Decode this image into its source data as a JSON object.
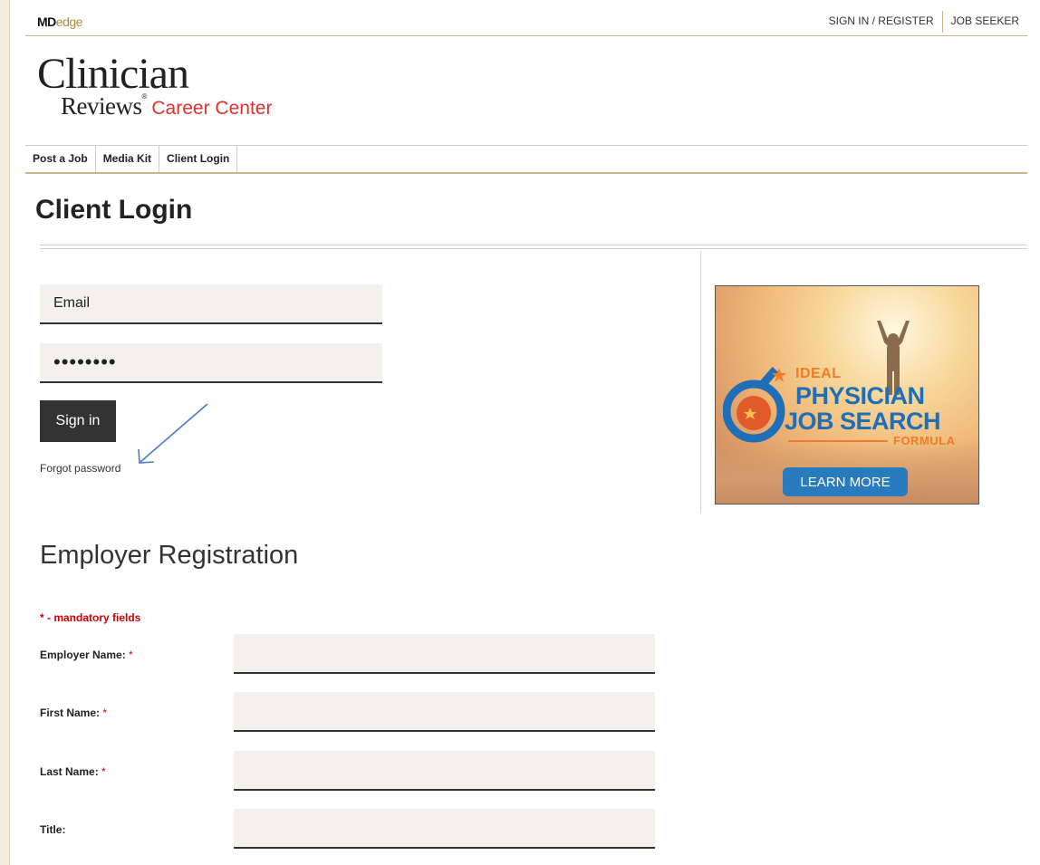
{
  "colors": {
    "accent_gold": "#c9b48a",
    "required_red": "#cc0000",
    "logo_red": "#e0302f",
    "button_dark": "#333333",
    "ad_blue": "#1e6fb8",
    "ad_orange": "#f07c28"
  },
  "brand": {
    "md": "MD",
    "edge": "edge"
  },
  "top_links": [
    "SIGN IN / REGISTER",
    "JOB SEEKER"
  ],
  "logo": {
    "main": "Clinician",
    "reviews": "Reviews",
    "reg_mark": "®",
    "career": "Career Center"
  },
  "nav": [
    "Post a Job",
    "Media Kit",
    "Client Login"
  ],
  "page_title": "Client Login",
  "login": {
    "email_placeholder": "Email",
    "password_value": "••••••••",
    "signin_label": "Sign in",
    "forgot_label": "Forgot password",
    "annotation_icon": "arrow-icon"
  },
  "ad": {
    "ideal": "IDEAL",
    "physician": "PHYSICIAN",
    "job_search": "JOB SEARCH",
    "formula": "FORMULA",
    "learn_more": "LEARN MORE"
  },
  "registration": {
    "title": "Employer Registration",
    "mandatory_note": "* - mandatory fields",
    "required_mark": "*",
    "fields": [
      {
        "label": "Employer Name:",
        "required": true
      },
      {
        "label": "First Name:",
        "required": true
      },
      {
        "label": "Last Name:",
        "required": true
      },
      {
        "label": "Title:",
        "required": false
      }
    ]
  }
}
